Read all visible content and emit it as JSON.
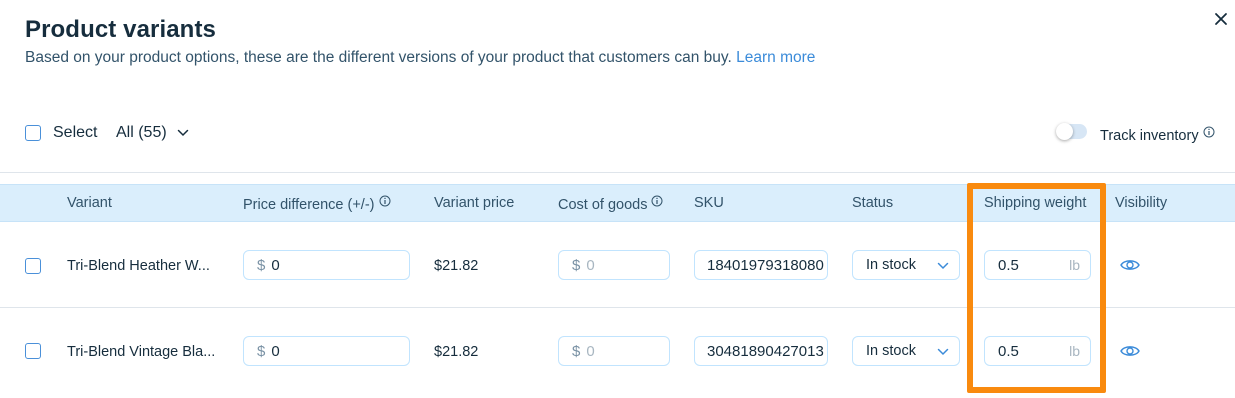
{
  "header": {
    "title": "Product variants",
    "subtitle": "Based on your product options, these are the different versions of your product that customers can buy.",
    "learn_more": "Learn more"
  },
  "toolbar": {
    "select_label": "Select",
    "filter_value": "All (55)",
    "track_inventory_label": "Track inventory",
    "track_inventory_enabled": false
  },
  "table": {
    "columns": {
      "variant": "Variant",
      "price_difference": "Price difference (+/-)",
      "variant_price": "Variant price",
      "cost_of_goods": "Cost of goods",
      "sku": "SKU",
      "status": "Status",
      "shipping_weight": "Shipping weight",
      "visibility": "Visibility"
    },
    "rows": [
      {
        "variant": "Tri-Blend Heather W...",
        "price_prefix": "$",
        "price_difference": "0",
        "variant_price": "$21.82",
        "cost_prefix": "$",
        "cost_placeholder": "0",
        "sku": "18401979318080",
        "status": "In stock",
        "weight": "0.5",
        "weight_unit": "lb"
      },
      {
        "variant": "Tri-Blend Vintage Bla...",
        "price_prefix": "$",
        "price_difference": "0",
        "variant_price": "$21.82",
        "cost_prefix": "$",
        "cost_placeholder": "0",
        "sku": "30481890427013",
        "status": "In stock",
        "weight": "0.5",
        "weight_unit": "lb"
      }
    ]
  },
  "colors": {
    "accent": "#3b8bd9",
    "header_bg": "#daeefc",
    "highlight": "#f98a0e"
  }
}
